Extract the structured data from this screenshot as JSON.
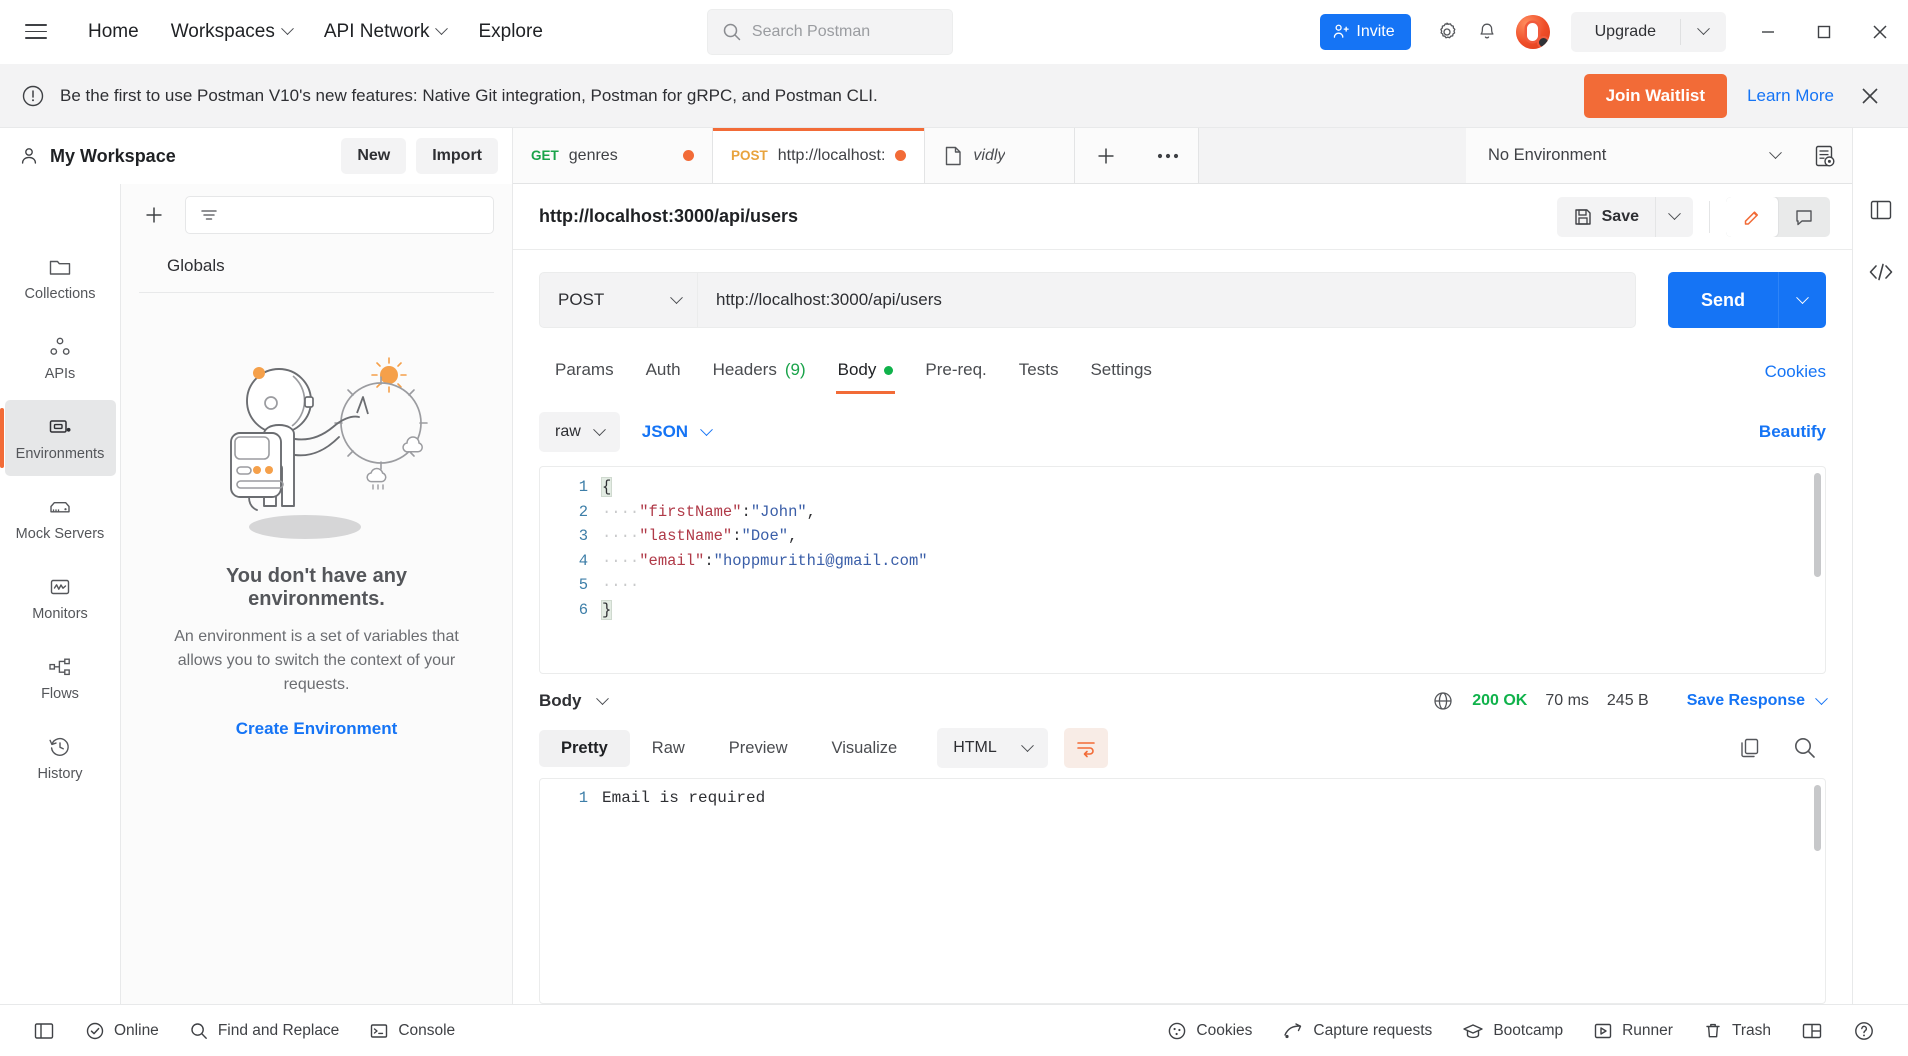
{
  "topbar": {
    "nav": [
      {
        "label": "Home",
        "caret": false
      },
      {
        "label": "Workspaces",
        "caret": true
      },
      {
        "label": "API Network",
        "caret": true
      },
      {
        "label": "Explore",
        "caret": false
      }
    ],
    "search_placeholder": "Search Postman",
    "search_value": "",
    "invite_label": "Invite",
    "upgrade_label": "Upgrade"
  },
  "banner": {
    "text": "Be the first to use Postman V10's new features: Native Git integration, Postman for gRPC, and Postman CLI.",
    "join_label": "Join Waitlist",
    "learn_label": "Learn More"
  },
  "rail": {
    "items": [
      {
        "label": "Collections",
        "icon": "folder-icon",
        "active": false
      },
      {
        "label": "APIs",
        "icon": "apis-icon",
        "active": false
      },
      {
        "label": "Environments",
        "icon": "environments-icon",
        "active": true
      },
      {
        "label": "Mock Servers",
        "icon": "mock-server-icon",
        "active": false
      },
      {
        "label": "Monitors",
        "icon": "monitor-icon",
        "active": false
      },
      {
        "label": "Flows",
        "icon": "flows-icon",
        "active": false
      },
      {
        "label": "History",
        "icon": "history-icon",
        "active": false
      }
    ]
  },
  "workspace": {
    "title": "My Workspace",
    "new_label": "New",
    "import_label": "Import",
    "filter_placeholder": "",
    "globals_label": "Globals",
    "empty": {
      "title": "You don't have any environments.",
      "description": "An environment is a set of variables that allows you to switch the context of your requests.",
      "cta": "Create Environment"
    }
  },
  "request_tabs": {
    "tabs": [
      {
        "method": "GET",
        "name": "genres",
        "unsaved": true,
        "active": false,
        "type": "request"
      },
      {
        "method": "POST",
        "name": "http://localhost:",
        "unsaved": true,
        "active": true,
        "type": "request"
      },
      {
        "method": "",
        "name": "vidly",
        "unsaved": false,
        "active": false,
        "type": "document"
      }
    ],
    "environment_selected": "No Environment"
  },
  "request": {
    "title": "http://localhost:3000/api/users",
    "save_label": "Save",
    "method": "POST",
    "url": "http://localhost:3000/api/users",
    "send_label": "Send",
    "tabs": [
      {
        "label": "Params",
        "active": false,
        "badge": "",
        "dot": false
      },
      {
        "label": "Auth",
        "active": false,
        "badge": "",
        "dot": false
      },
      {
        "label": "Headers",
        "active": false,
        "badge": "(9)",
        "dot": false
      },
      {
        "label": "Body",
        "active": true,
        "badge": "",
        "dot": true
      },
      {
        "label": "Pre-req.",
        "active": false,
        "badge": "",
        "dot": false
      },
      {
        "label": "Tests",
        "active": false,
        "badge": "",
        "dot": false
      },
      {
        "label": "Settings",
        "active": false,
        "badge": "",
        "dot": false
      }
    ],
    "cookies_link": "Cookies",
    "body_mode": "raw",
    "body_format": "JSON",
    "beautify_label": "Beautify",
    "code_lines": [
      {
        "num": "1",
        "tokens": [
          {
            "t": "brace",
            "v": "{"
          }
        ]
      },
      {
        "num": "2",
        "tokens": [
          {
            "t": "dots",
            "v": "····"
          },
          {
            "t": "key",
            "v": "\"firstName\""
          },
          {
            "t": "punct",
            "v": ":"
          },
          {
            "t": "str",
            "v": "\"John\""
          },
          {
            "t": "punct",
            "v": ","
          }
        ]
      },
      {
        "num": "3",
        "tokens": [
          {
            "t": "dots",
            "v": "····"
          },
          {
            "t": "key",
            "v": "\"lastName\""
          },
          {
            "t": "punct",
            "v": ":"
          },
          {
            "t": "str",
            "v": "\"Doe\""
          },
          {
            "t": "punct",
            "v": ","
          }
        ]
      },
      {
        "num": "4",
        "tokens": [
          {
            "t": "dots",
            "v": "····"
          },
          {
            "t": "key",
            "v": "\"email\""
          },
          {
            "t": "punct",
            "v": ":"
          },
          {
            "t": "str",
            "v": "\"hoppmurithi@gmail.com\""
          }
        ]
      },
      {
        "num": "5",
        "tokens": [
          {
            "t": "dots",
            "v": "····"
          }
        ]
      },
      {
        "num": "6",
        "tokens": [
          {
            "t": "brace",
            "v": "}"
          }
        ]
      }
    ]
  },
  "response": {
    "body_label": "Body",
    "status": "200 OK",
    "time": "70 ms",
    "size": "245 B",
    "save_response_label": "Save Response",
    "tabs": [
      {
        "label": "Pretty",
        "active": true
      },
      {
        "label": "Raw",
        "active": false
      },
      {
        "label": "Preview",
        "active": false
      },
      {
        "label": "Visualize",
        "active": false
      }
    ],
    "format": "HTML",
    "line_number": "1",
    "content": "Email is required"
  },
  "statusbar": {
    "left": [
      {
        "label": "Online",
        "icon": "online-icon"
      },
      {
        "label": "Find and Replace",
        "icon": "search-icon"
      },
      {
        "label": "Console",
        "icon": "console-icon"
      }
    ],
    "right": [
      {
        "label": "Cookies",
        "icon": "cookie-icon"
      },
      {
        "label": "Capture requests",
        "icon": "capture-icon"
      },
      {
        "label": "Bootcamp",
        "icon": "bootcamp-icon"
      },
      {
        "label": "Runner",
        "icon": "runner-icon"
      },
      {
        "label": "Trash",
        "icon": "trash-icon"
      }
    ]
  },
  "colors": {
    "accent_orange": "#f26b37",
    "accent_blue": "#1574f5",
    "success_green": "#10b24b",
    "get_green": "#1aa34a",
    "post_orange": "#e8a33d"
  }
}
